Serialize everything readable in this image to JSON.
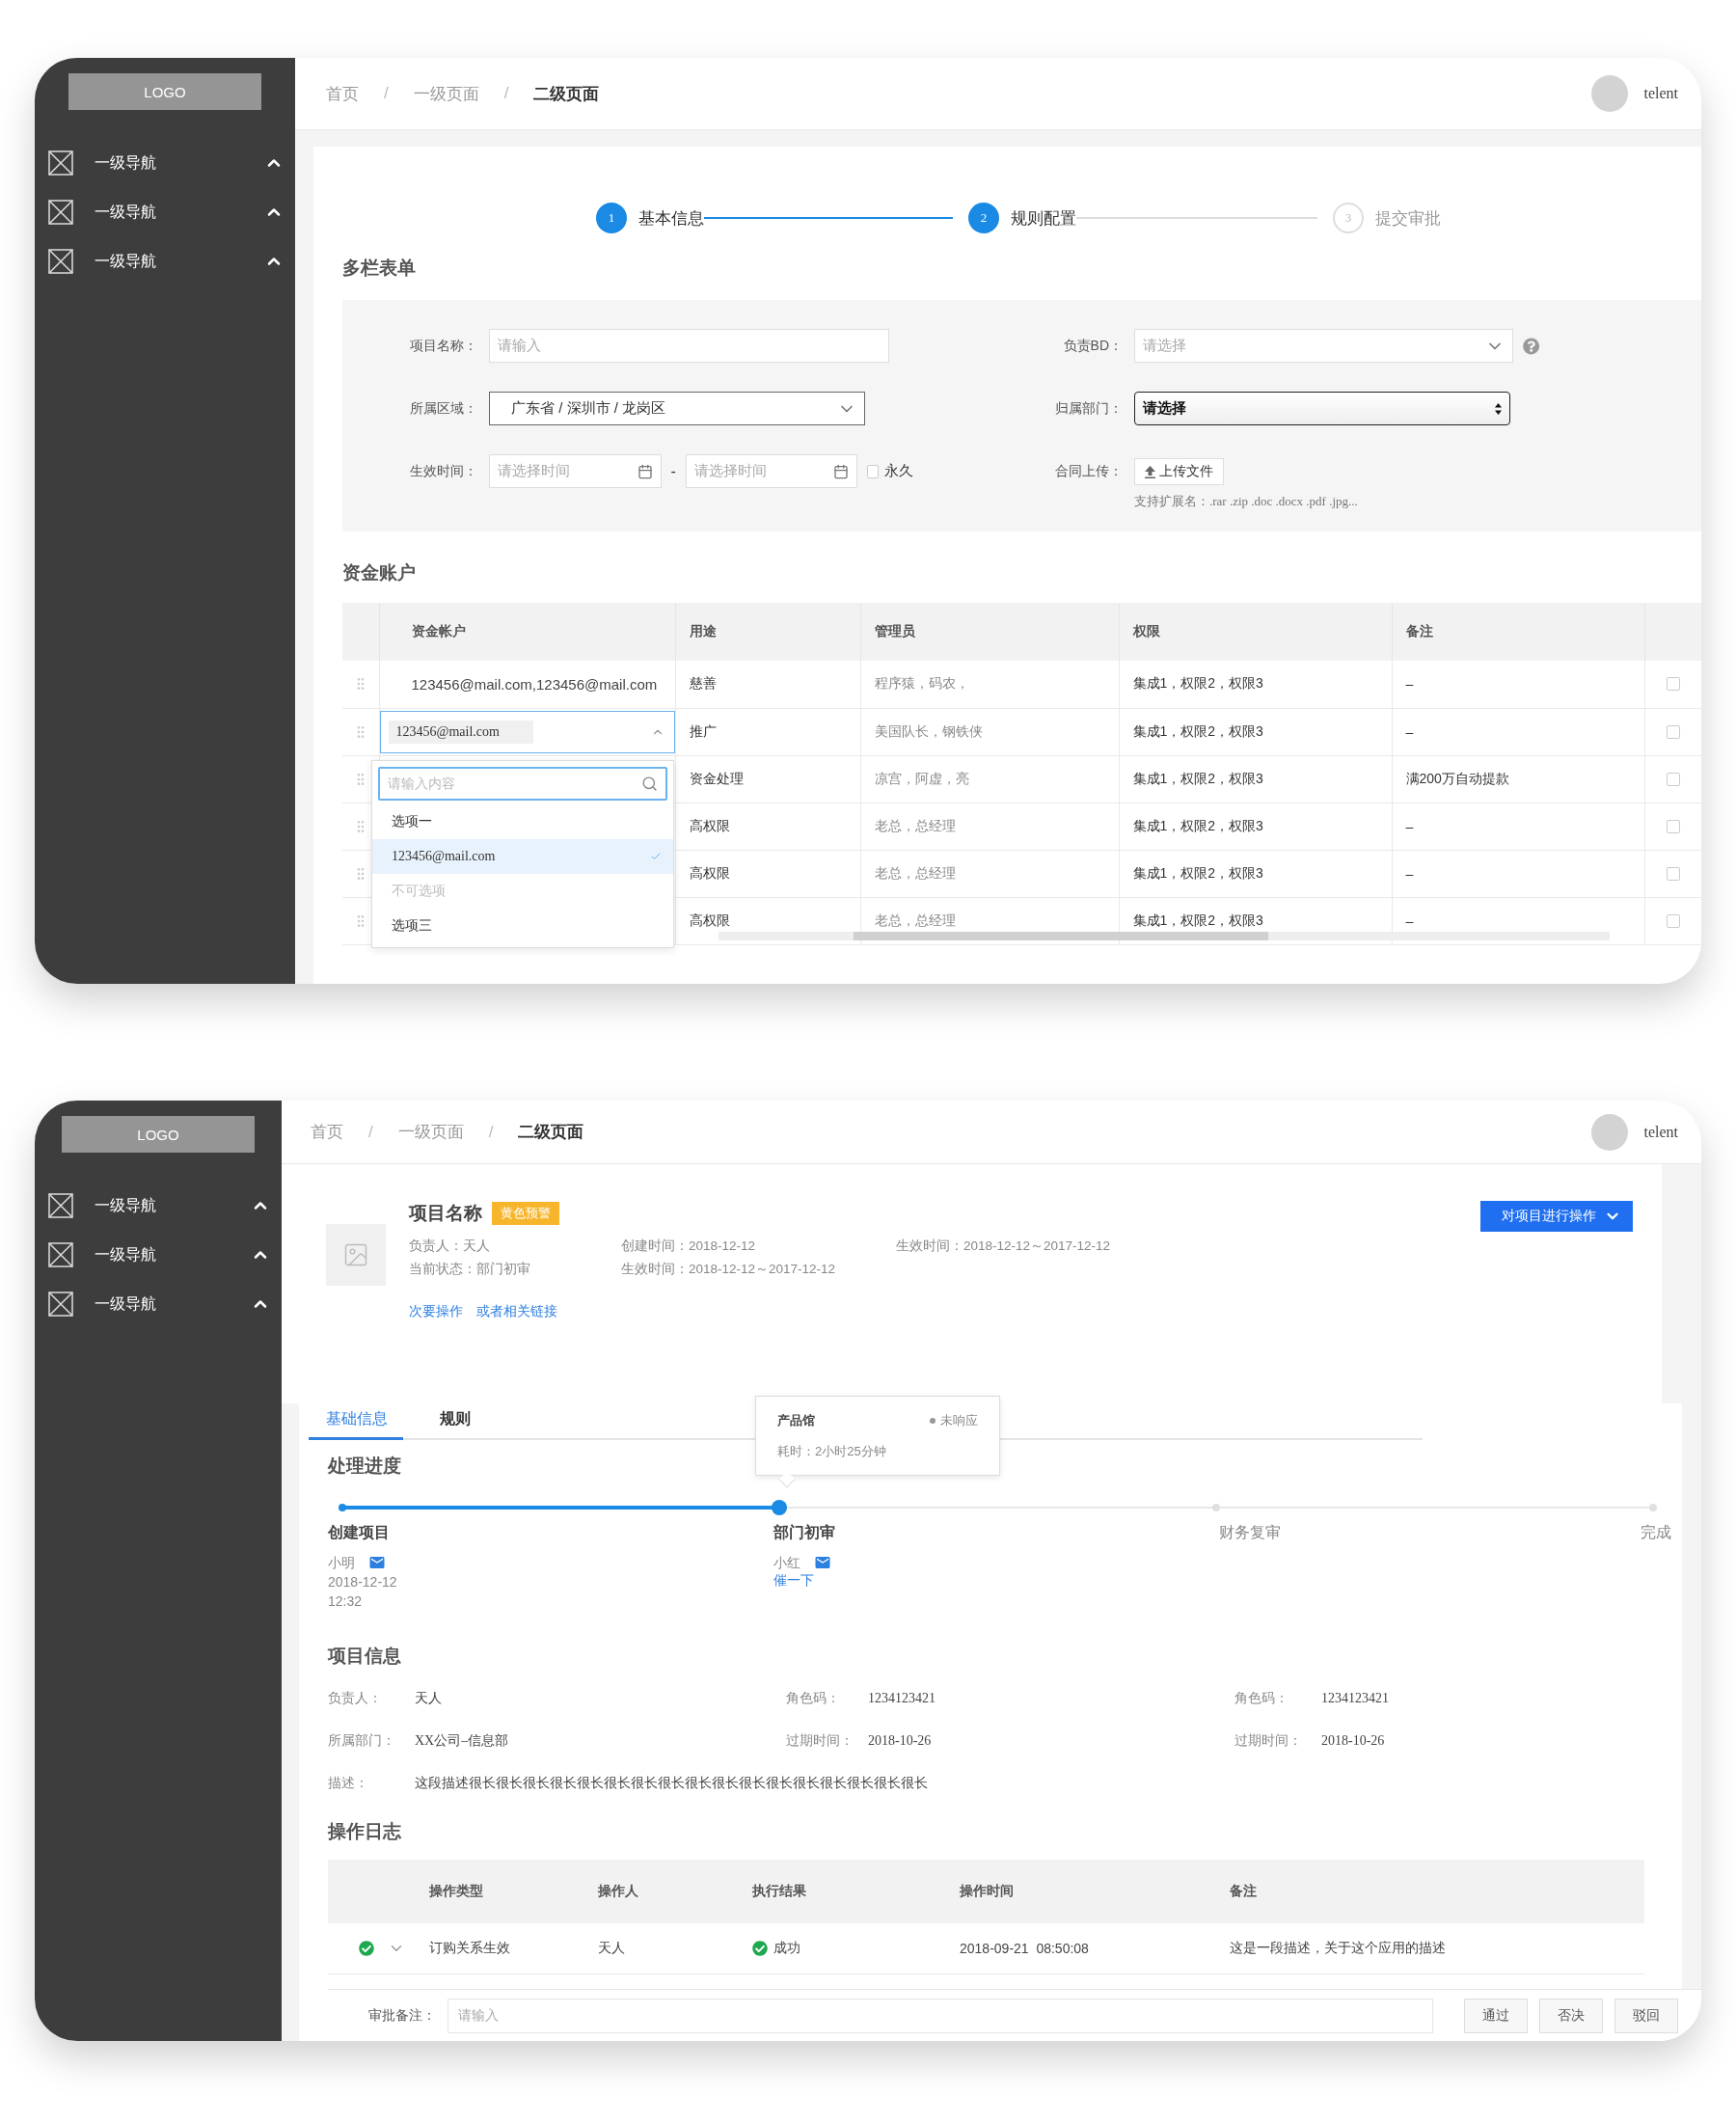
{
  "form_screen": {
    "sidebar": {
      "logo": "LOGO",
      "items": [
        {
          "label": "一级导航"
        },
        {
          "label": "一级导航"
        },
        {
          "label": "一级导航"
        }
      ]
    },
    "breadcrumb": [
      {
        "label": "首页",
        "current": false,
        "separator": "/"
      },
      {
        "label": "一级页面",
        "current": false,
        "separator": "/"
      },
      {
        "label": "二级页面",
        "current": true
      }
    ],
    "user": {
      "name": "telent"
    },
    "steps": [
      {
        "number": "1",
        "label": "基本信息",
        "active": true
      },
      {
        "number": "2",
        "label": "规则配置",
        "active": true
      },
      {
        "number": "3",
        "label": "提交审批",
        "active": false
      }
    ],
    "form": {
      "title": "多栏表单",
      "fields": [
        {
          "kind": "input",
          "label": "项目名称：",
          "placeholder": "请输入"
        },
        {
          "kind": "select",
          "label": "负责BD：",
          "placeholder": "请选择",
          "help": true
        },
        {
          "kind": "cascader",
          "label": "所属区域：",
          "value": "广东省 / 深圳市 / 龙岗区"
        },
        {
          "kind": "native_select",
          "label": "归属部门：",
          "value": "请选择"
        },
        {
          "kind": "date_range",
          "label": "生效时间：",
          "start_placeholder": "请选择时间",
          "separator": "-",
          "end_placeholder": "请选择时间",
          "checkbox": {
            "label": "永久",
            "checked": false
          }
        },
        {
          "kind": "upload",
          "label": "合同上传：",
          "button": "上传文件",
          "hint": "支持扩展名：.rar .zip .doc .docx .pdf .jpg..."
        }
      ]
    },
    "accounts": {
      "title": "资金账户",
      "columns": [
        "资金帐户",
        "用途",
        "管理员",
        "权限",
        "备注"
      ],
      "rows": [
        {
          "kind": "text",
          "account": "123456@mail.com,123456@mail.com",
          "usage": "慈善",
          "admins": "程序猿，码农，",
          "rights": "集成1，权限2，权限3",
          "note": "–",
          "checked": false
        },
        {
          "kind": "select",
          "tag": "123456@mail.com",
          "usage": "推广",
          "admins": "美国队长，钢铁侠",
          "rights": "集成1，权限2，权限3",
          "note": "–",
          "checked": false
        },
        {
          "kind": "covered",
          "usage": "资金处理",
          "admins": "凉宫，阿虚，亮",
          "rights": "集成1，权限2，权限3",
          "note": "满200万自动提款",
          "checked": false
        },
        {
          "kind": "covered",
          "usage": "高权限",
          "admins": "老总，总经理",
          "rights": "集成1，权限2，权限3",
          "note": "–",
          "checked": false
        },
        {
          "kind": "covered",
          "usage": "高权限",
          "admins": "老总，总经理",
          "rights": "集成1，权限2，权限3",
          "note": "–",
          "checked": false
        },
        {
          "kind": "covered",
          "usage": "高权限",
          "admins": "老总，总经理",
          "rights": "集成1，权限2，权限3",
          "note": "–",
          "checked": false
        }
      ],
      "dropdown": {
        "placeholder": "请输入内容",
        "options": [
          {
            "label": "选项一",
            "selected": false,
            "disabled": false
          },
          {
            "label": "123456@mail.com",
            "selected": true,
            "disabled": false
          },
          {
            "label": "不可选项",
            "selected": false,
            "disabled": true
          },
          {
            "label": "选项三",
            "selected": false,
            "disabled": false
          }
        ]
      }
    }
  },
  "detail_screen": {
    "sidebar": {
      "logo": "LOGO",
      "items": [
        {
          "label": "一级导航"
        },
        {
          "label": "一级导航"
        },
        {
          "label": "一级导航"
        }
      ]
    },
    "breadcrumb": [
      {
        "label": "首页",
        "current": false,
        "separator": "/"
      },
      {
        "label": "一级页面",
        "current": false,
        "separator": "/"
      },
      {
        "label": "二级页面",
        "current": true
      }
    ],
    "user": {
      "name": "telent"
    },
    "project": {
      "title": "项目名称",
      "badge": "黄色预警",
      "meta": [
        [
          "负责人：天人",
          "当前状态：部门初审"
        ],
        [
          "创建时间：2018-12-12",
          "生效时间：2018-12-12～2017-12-12"
        ],
        [
          "生效时间：2018-12-12～2017-12-12"
        ]
      ],
      "links": [
        "次要操作",
        "或者相关链接"
      ],
      "action": "对项目进行操作"
    },
    "tabs": [
      {
        "label": "基础信息",
        "selected": true
      },
      {
        "label": "规则",
        "selected": false
      }
    ],
    "popover": {
      "title": "产品馆",
      "status": "未响应",
      "detail": "耗时：2小时25分钟"
    },
    "progress": {
      "title": "处理进度",
      "steps": [
        {
          "label": "创建项目",
          "finished": true,
          "current": false,
          "person": "小明",
          "date": "2018-12-12",
          "time": "12:32"
        },
        {
          "label": "部门初审",
          "finished": false,
          "current": true,
          "person": "小红",
          "link": "催一下"
        },
        {
          "label": "财务复审",
          "finished": false,
          "current": false
        },
        {
          "label": "完成",
          "finished": false,
          "current": false
        }
      ]
    },
    "info": {
      "title": "项目信息",
      "rows": [
        [
          {
            "label": "负责人：",
            "value": "天人"
          },
          {
            "label": "角色码：",
            "value": "1234123421"
          },
          {
            "label": "角色码：",
            "value": "1234123421"
          }
        ],
        [
          {
            "label": "所属部门：",
            "value": "XX公司–信息部"
          },
          {
            "label": "过期时间：",
            "value": "2018-10-26"
          },
          {
            "label": "过期时间：",
            "value": "2018-10-26"
          }
        ],
        [
          {
            "label": "描述：",
            "value": "这段描述很长很长很长很长很长很长很长很长很长很长很长很长很长很长很长很长很长"
          }
        ]
      ]
    },
    "log": {
      "title": "操作日志",
      "columns": [
        "操作类型",
        "操作人",
        "执行结果",
        "操作时间",
        "备注"
      ],
      "rows": [
        {
          "type": "订购关系生效",
          "operator": "天人",
          "result": "成功",
          "time": "2018-09-21  08:50:08",
          "note": "这是一段描述，关于这个应用的描述"
        }
      ]
    },
    "approval": {
      "label": "审批备注：",
      "placeholder": "请输入",
      "buttons": [
        "通过",
        "否决",
        "驳回"
      ]
    }
  }
}
